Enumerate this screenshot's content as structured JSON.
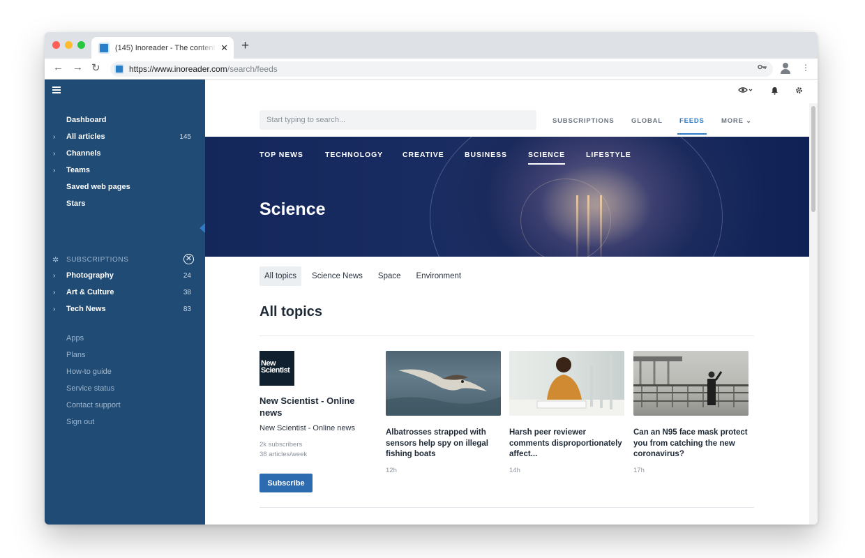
{
  "browser": {
    "tab_title": "(145) Inoreader - The content",
    "tab_close": "✕",
    "new_tab": "+",
    "url_host": "https://www.inoreader.com",
    "url_path": "/search/feeds"
  },
  "sidebar": {
    "items": [
      {
        "label": "Dashboard",
        "count": "",
        "chevron": ""
      },
      {
        "label": "All articles",
        "count": "145",
        "chevron": "›"
      },
      {
        "label": "Channels",
        "count": "",
        "chevron": "›"
      },
      {
        "label": "Teams",
        "count": "",
        "chevron": "›"
      },
      {
        "label": "Saved web pages",
        "count": "",
        "chevron": ""
      },
      {
        "label": "Stars",
        "count": "",
        "chevron": ""
      }
    ],
    "subscriptions_header": "SUBSCRIPTIONS",
    "subscriptions": [
      {
        "label": "Photography",
        "count": "24"
      },
      {
        "label": "Art & Culture",
        "count": "38"
      },
      {
        "label": "Tech News",
        "count": "83"
      }
    ],
    "links": [
      "Apps",
      "Plans",
      "How-to guide",
      "Service status",
      "Contact support",
      "Sign out"
    ]
  },
  "search": {
    "placeholder": "Start typing to search...",
    "tabs": [
      "SUBSCRIPTIONS",
      "GLOBAL",
      "FEEDS",
      "MORE ⌄"
    ],
    "active_tab": "FEEDS"
  },
  "banner": {
    "tabs": [
      "TOP NEWS",
      "TECHNOLOGY",
      "CREATIVE",
      "BUSINESS",
      "SCIENCE",
      "LIFESTYLE"
    ],
    "active_tab": "SCIENCE",
    "title": "Science"
  },
  "topics": {
    "chips": [
      "All topics",
      "Science News",
      "Space",
      "Environment"
    ],
    "active_chip": "All topics",
    "section_title": "All topics"
  },
  "feed": {
    "logo_text_1": "New",
    "logo_text_2": "Scientist",
    "title": "New Scientist - Online news",
    "subtitle": "New Scientist - Online news",
    "subscribers": "2k subscribers",
    "frequency": "38 articles/week",
    "subscribe_label": "Subscribe"
  },
  "articles": [
    {
      "title": "Albatrosses strapped with sensors help spy on illegal fishing boats",
      "time": "12h",
      "image": "albatross-photo"
    },
    {
      "title": "Harsh peer reviewer comments disproportionately affect...",
      "time": "14h",
      "image": "student-writing-photo"
    },
    {
      "title": "Can an N95 face mask protect you from catching the new coronavirus?",
      "time": "17h",
      "image": "bridge-mask-photo"
    }
  ],
  "colors": {
    "sidebar_bg": "#1f4b75",
    "accent": "#2f79c5",
    "subscribe_button": "#2d6bb1",
    "banner_bg": "#14275b"
  }
}
